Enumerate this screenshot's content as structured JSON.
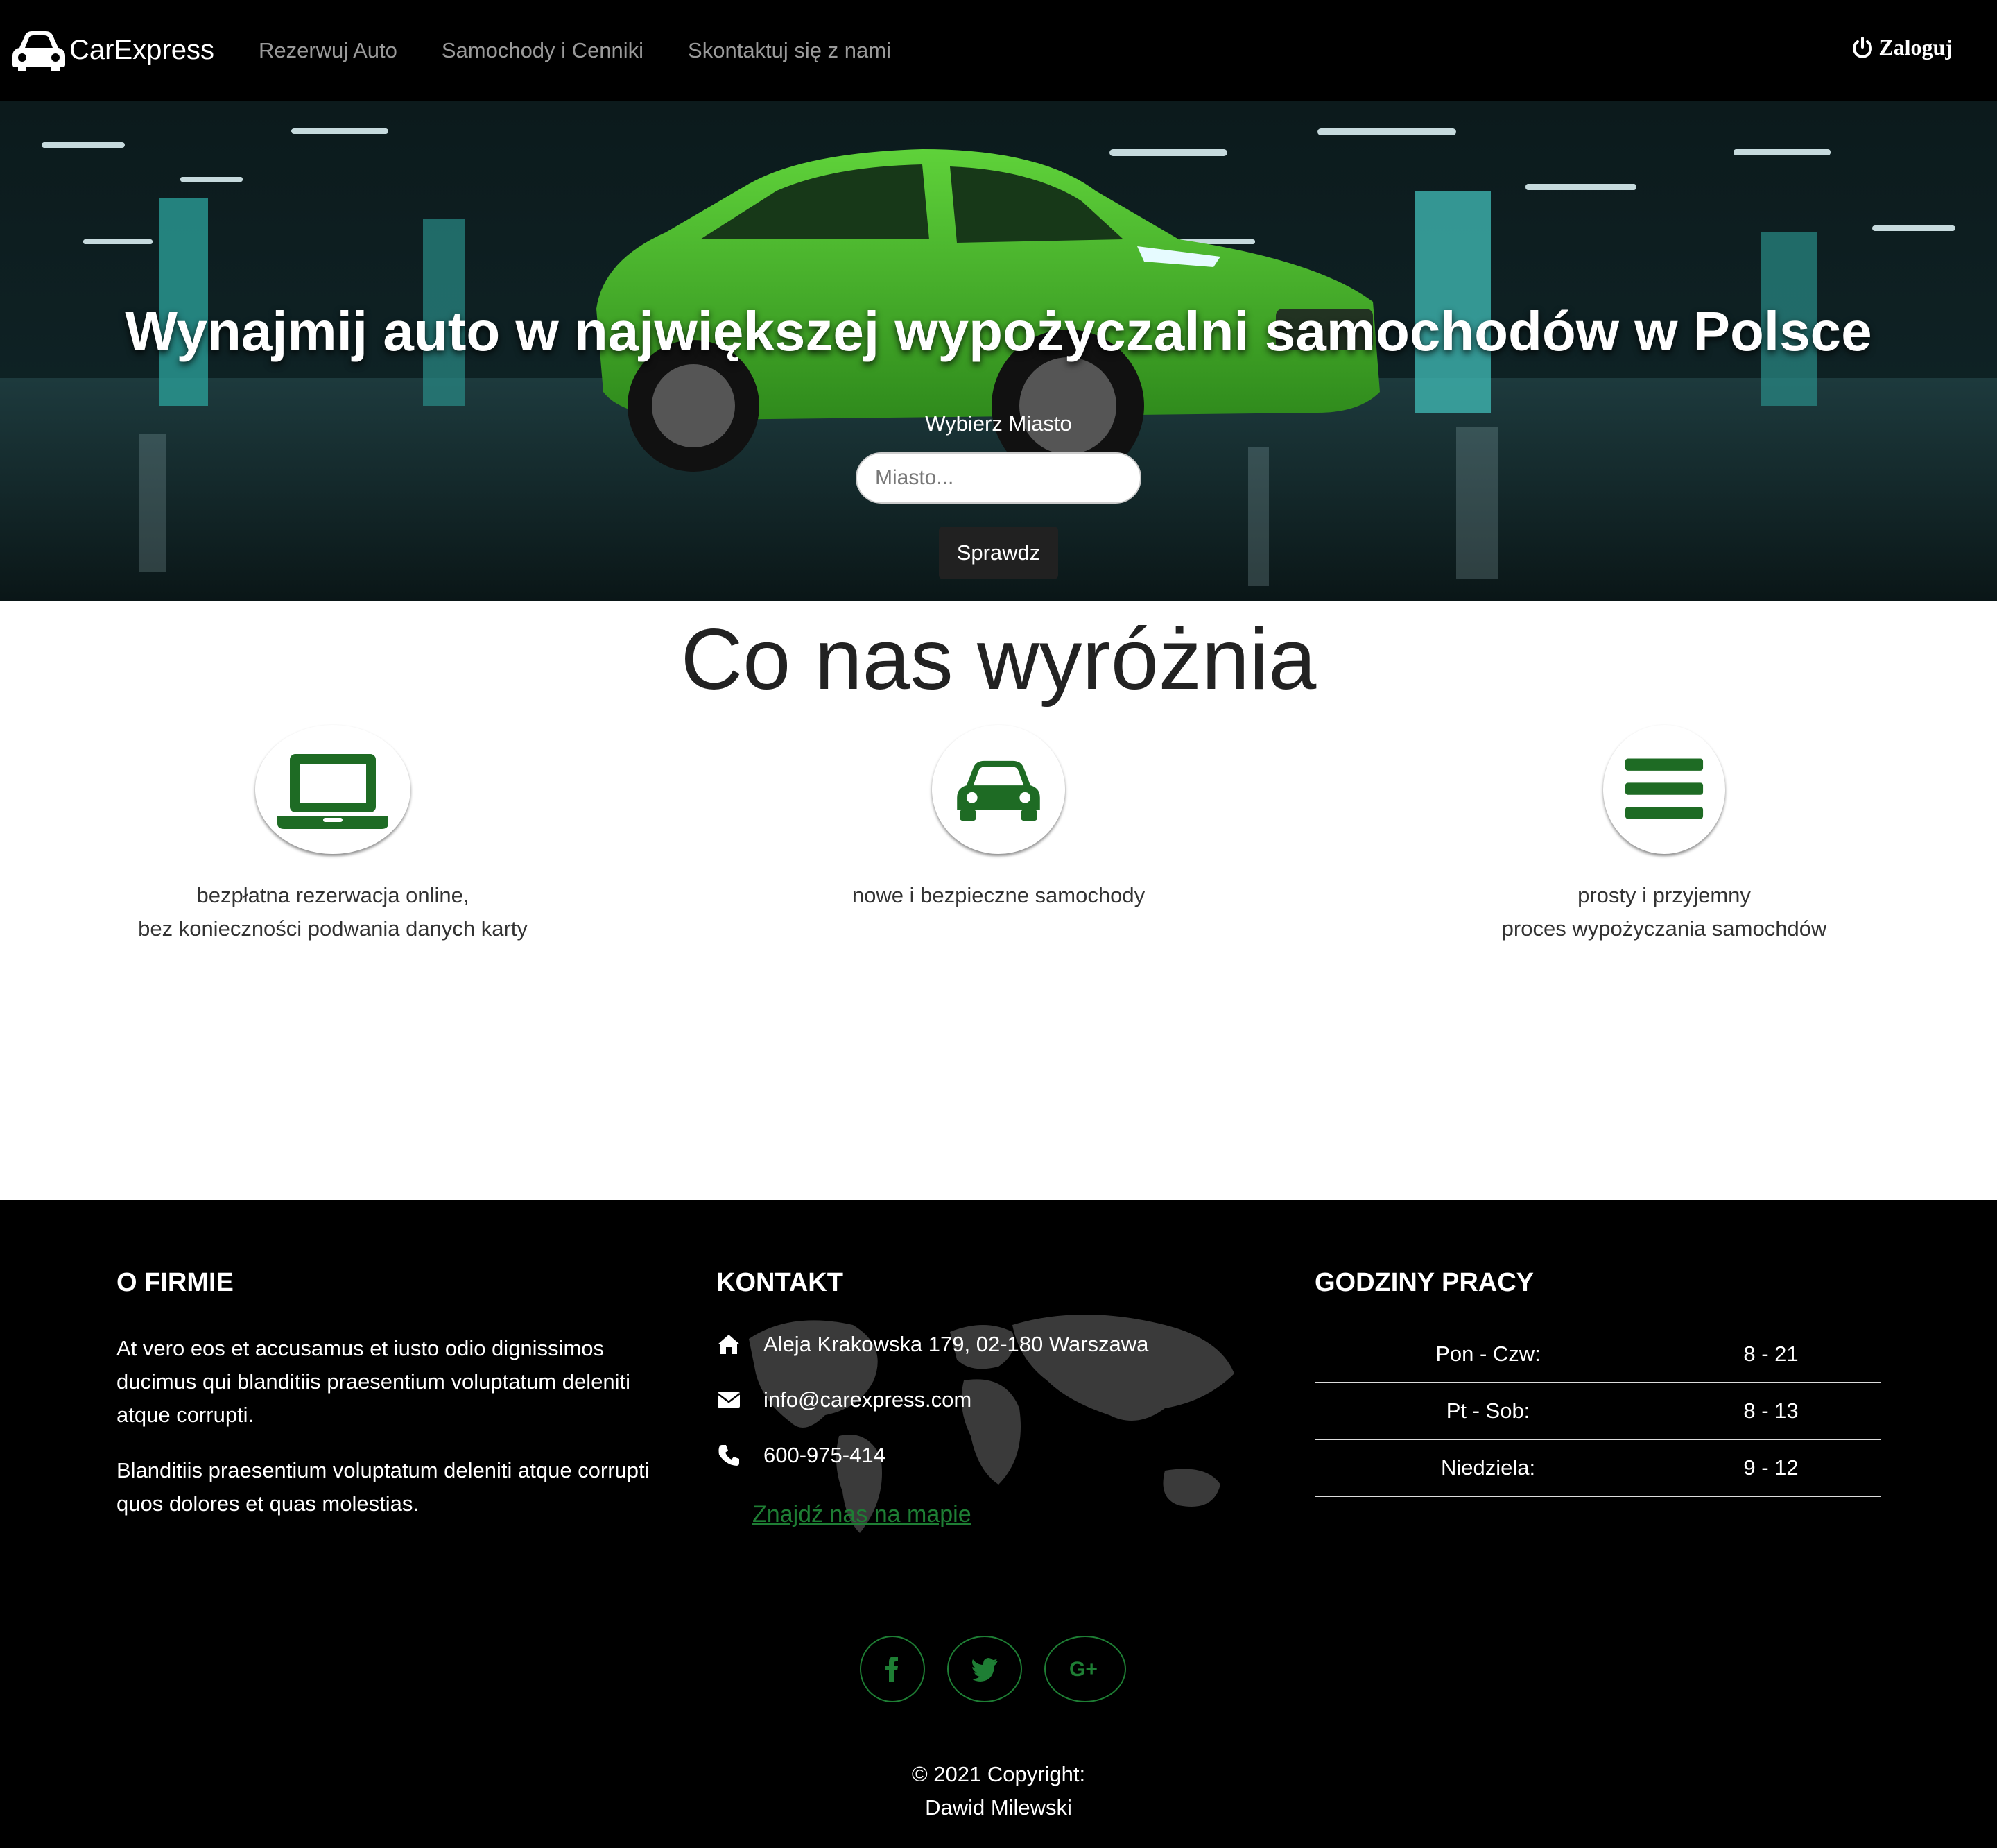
{
  "nav": {
    "brand": "CarExpress",
    "links": [
      "Rezerwuj Auto",
      "Samochody i Cenniki",
      "Skontaktuj się z nami"
    ],
    "login": "Zaloguj"
  },
  "hero": {
    "title": "Wynajmij auto w największej wypożyczalni samochodów w Polsce",
    "city_label": "Wybierz Miasto",
    "city_placeholder": "Miasto...",
    "button": "Sprawdz"
  },
  "features": {
    "title": "Co nas wyróżnia",
    "items": [
      {
        "icon": "laptop-icon",
        "line1": "bezpłatna rezerwacja online,",
        "line2": "bez konieczności podwania danych karty"
      },
      {
        "icon": "car-icon",
        "line1": "nowe i bezpieczne samochody",
        "line2": ""
      },
      {
        "icon": "bars-icon",
        "line1": "prosty i przyjemny",
        "line2": "proces wypożyczania samochdów"
      }
    ]
  },
  "footer": {
    "about": {
      "heading": "O FIRMIE",
      "p1": "At vero eos et accusamus et iusto odio dignissimos ducimus qui blanditiis praesentium voluptatum deleniti atque corrupti.",
      "p2": "Blanditiis praesentium voluptatum deleniti atque corrupti quos dolores et quas molestias."
    },
    "contact": {
      "heading": "KONTAKT",
      "address": "Aleja Krakowska 179, 02-180 Warszawa",
      "email": "info@carexpress.com",
      "phone": "600-975-414",
      "map_link": "Znajdź nas na mapie"
    },
    "hours": {
      "heading": "GODZINY PRACY",
      "rows": [
        {
          "day": "Pon - Czw:",
          "time": "8 - 21"
        },
        {
          "day": "Pt - Sob:",
          "time": "8 - 13"
        },
        {
          "day": "Niedziela:",
          "time": "9 - 12"
        }
      ]
    },
    "social": [
      "facebook-icon",
      "twitter-icon",
      "google-plus-icon"
    ],
    "copyright_line1": "© 2021 Copyright:",
    "copyright_line2": "Dawid Milewski"
  },
  "colors": {
    "accent": "#1e6b24",
    "link": "#1e7e34",
    "nav_bg": "#000000"
  }
}
